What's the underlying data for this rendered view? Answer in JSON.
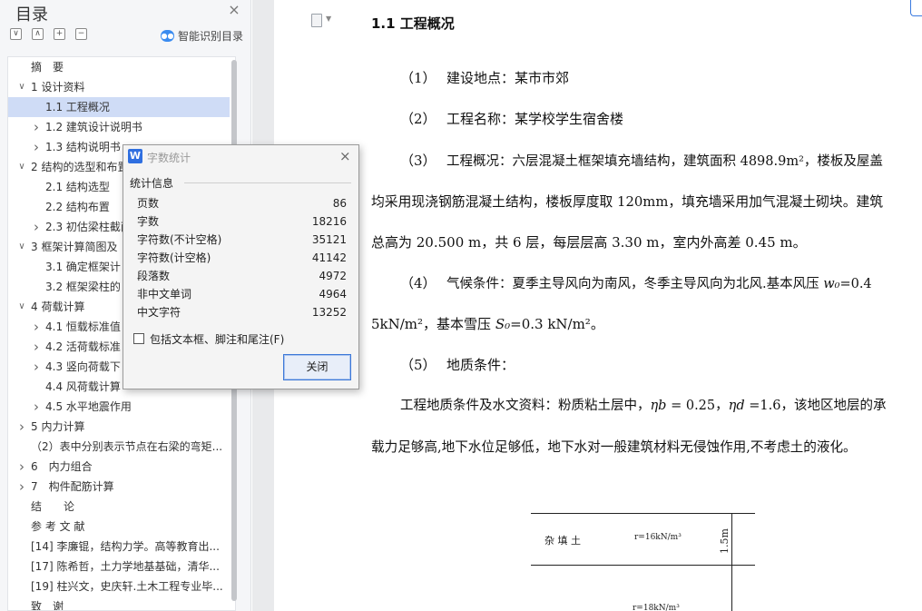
{
  "toc": {
    "title": "目录",
    "close_glyph": "×",
    "toolbar": [
      "v",
      "^",
      "+",
      "-"
    ],
    "smart_label": "智能识别目录",
    "items": [
      {
        "label": "摘　要",
        "level": 0,
        "expand": ""
      },
      {
        "label": "1 设计资料",
        "level": 0,
        "expand": "v"
      },
      {
        "label": "1.1 工程概况",
        "level": 1,
        "expand": "",
        "selected": true
      },
      {
        "label": "1.2 建筑设计说明书",
        "level": 1,
        "expand": ">"
      },
      {
        "label": "1.3 结构说明书",
        "level": 1,
        "expand": ">"
      },
      {
        "label": "2 结构的选型和布置",
        "level": 0,
        "expand": "v"
      },
      {
        "label": "2.1 结构选型",
        "level": 1,
        "expand": ""
      },
      {
        "label": "2.2 结构布置",
        "level": 1,
        "expand": ""
      },
      {
        "label": "2.3 初估梁柱截面",
        "level": 1,
        "expand": ">"
      },
      {
        "label": "3 框架计算简图及",
        "level": 0,
        "expand": "v"
      },
      {
        "label": "3.1 确定框架计",
        "level": 1,
        "expand": ""
      },
      {
        "label": "3.2 框架梁柱的",
        "level": 1,
        "expand": ""
      },
      {
        "label": "4 荷载计算",
        "level": 0,
        "expand": "v"
      },
      {
        "label": "4.1 恒载标准值",
        "level": 1,
        "expand": ">"
      },
      {
        "label": "4.2 活荷载标准",
        "level": 1,
        "expand": ">"
      },
      {
        "label": "4.3 竖向荷载下",
        "level": 1,
        "expand": ">"
      },
      {
        "label": "4.4 风荷载计算",
        "level": 1,
        "expand": ""
      },
      {
        "label": "4.5 水平地震作用",
        "level": 1,
        "expand": ">"
      },
      {
        "label": "5 内力计算",
        "level": 0,
        "expand": ">"
      },
      {
        "label": "（2）表中分别表示节点在右梁的弯矩...",
        "level": 0,
        "expand": ""
      },
      {
        "label": "6　内力组合",
        "level": 0,
        "expand": ">"
      },
      {
        "label": "7　构件配筋计算",
        "level": 0,
        "expand": ">"
      },
      {
        "label": "结　　论",
        "level": 0,
        "expand": ""
      },
      {
        "label": "参 考 文 献",
        "level": 0,
        "expand": ""
      },
      {
        "label": "[14] 李廉锟，结构力学。高等教育出...",
        "level": 0,
        "expand": ""
      },
      {
        "label": "[17] 陈希哲，土力学地基基础，清华...",
        "level": 0,
        "expand": ""
      },
      {
        "label": "[19] 柱兴文，史庆轩.土木工程专业毕...",
        "level": 0,
        "expand": ""
      },
      {
        "label": "致　谢",
        "level": 0,
        "expand": ""
      }
    ]
  },
  "document": {
    "heading": "1.1  工程概况",
    "p1_num": "（1）",
    "p1": "建设地点：某市市郊",
    "p2_num": "（2）",
    "p2": "工程名称：某学校学生宿舍楼",
    "p3_num": "（3）",
    "p3_a": "工程概况：六层混凝土框架填充墙结构，建筑面积 4898.9m²，楼板及屋盖",
    "p3_b": "均采用现浇钢筋混凝土结构，楼板厚度取 120mm，填充墙采用加气混凝土砌块。建筑",
    "p3_c": "总高为 20.500 m，共 6 层，每层层高 3.30 m，室内外高差 0.45 m。",
    "p4_num": "（4）",
    "p4_a_pre": "气候条件：夏季主导风向为南风，冬季主导风向为北风.基本风压 ",
    "p4_a_math": "w₀",
    "p4_a_post": "=0.4",
    "p4_b_pre": "5kN/m²，基本雪压 ",
    "p4_b_math": "S₀",
    "p4_b_post": "=0.3 kN/m²。",
    "p5_num": "（5）",
    "p5": "地质条件：",
    "p6_a_pre": "工程地质条件及水文资料：粉质粘土层中，",
    "p6_eta_b": "ηb",
    "p6_eta_b_val": " = 0.25，",
    "p6_eta_d": "ηd",
    "p6_eta_d_val": " =1.6，该地区地层的承",
    "p6_b": "载力足够高,地下水位足够低，地下水对一般建筑材料无侵蚀作用,不考虑土的液化。",
    "soil_name": "杂 填 土",
    "soil_gamma": "r=16kN/m³",
    "soil_depth": "1.5m",
    "soil_gamma2": "r=18kN/m³"
  },
  "dialog": {
    "logo": "W",
    "title": "字数统计",
    "close_glyph": "×",
    "group_label": "统计信息",
    "stats": [
      {
        "key": "页数",
        "value": "86"
      },
      {
        "key": "字数",
        "value": "18216"
      },
      {
        "key": "字符数(不计空格)",
        "value": "35121"
      },
      {
        "key": "字符数(计空格)",
        "value": "41142"
      },
      {
        "key": "段落数",
        "value": "4972"
      },
      {
        "key": "非中文单词",
        "value": "4964"
      },
      {
        "key": "中文字符",
        "value": "13252"
      }
    ],
    "checkbox_label": "包括文本框、脚注和尾注(F)",
    "checkbox_checked": false,
    "close_label": "关闭"
  }
}
